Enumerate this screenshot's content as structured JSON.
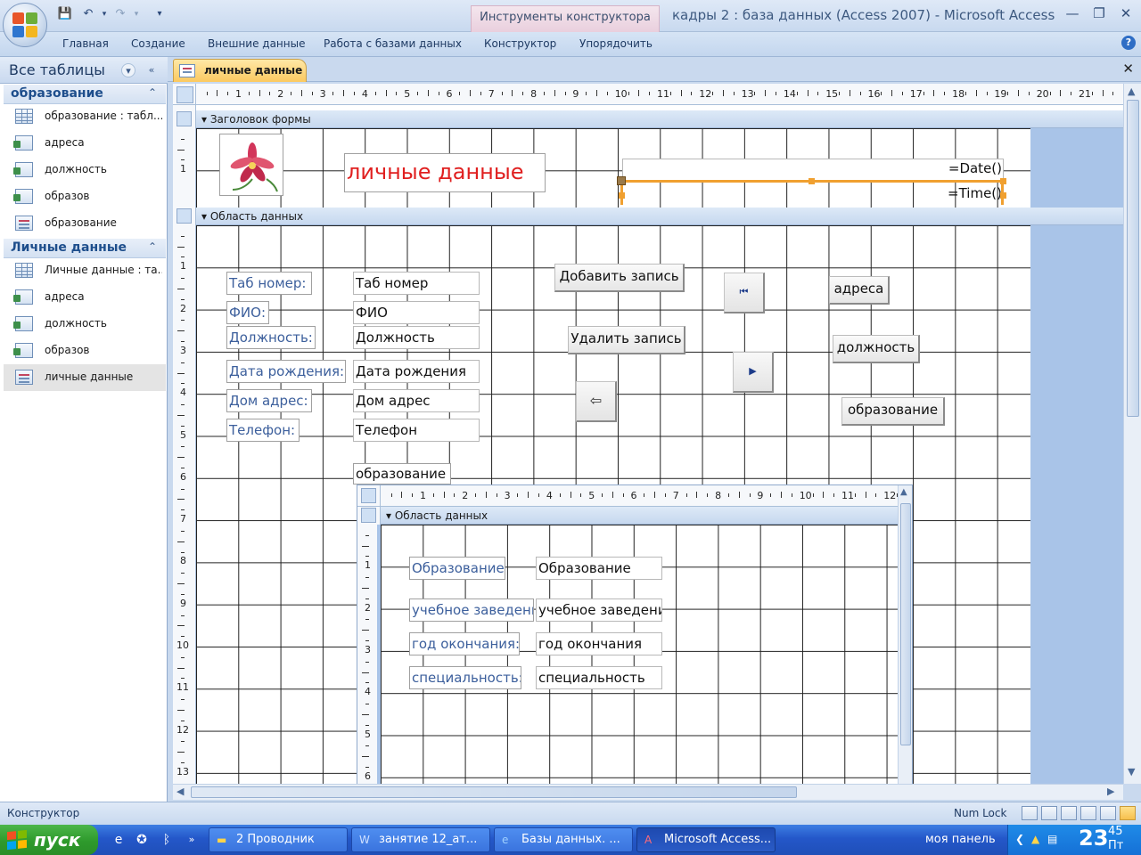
{
  "window": {
    "title": "кадры 2 : база данных (Access 2007) - Microsoft Access",
    "context_tab": "Инструменты конструктора форм",
    "minimize_glyph": "—",
    "maximize_glyph": "❐",
    "close_glyph": "✕"
  },
  "qat": {
    "save_icon": "save-icon",
    "undo_icon": "undo-icon",
    "redo_icon": "redo-icon",
    "customize_icon": "chevron-down-icon"
  },
  "ribbon": {
    "tabs": [
      "Главная",
      "Создание",
      "Внешние данные",
      "Работа с базами данных",
      "Конструктор",
      "Упорядочить"
    ],
    "help_glyph": "?"
  },
  "nav": {
    "title": "Все таблицы",
    "groups": [
      {
        "label": "образование",
        "items": [
          {
            "label": "образование : табл...",
            "icon": "table-icon"
          },
          {
            "label": "адреса",
            "icon": "query-icon"
          },
          {
            "label": "должность",
            "icon": "query-icon"
          },
          {
            "label": "образов",
            "icon": "query-icon"
          },
          {
            "label": "образование",
            "icon": "form-icon"
          }
        ]
      },
      {
        "label": "Личные данные",
        "items": [
          {
            "label": "Личные данные : та...",
            "icon": "table-icon"
          },
          {
            "label": "адреса",
            "icon": "query-icon"
          },
          {
            "label": "должность",
            "icon": "query-icon"
          },
          {
            "label": "образов",
            "icon": "query-icon"
          },
          {
            "label": "личные данные",
            "icon": "form-icon"
          }
        ]
      }
    ]
  },
  "document": {
    "tab_label": "личные данные",
    "close_glyph": "✕"
  },
  "ruler": {
    "h_numbers": [
      "1",
      "2",
      "3",
      "4",
      "5",
      "6",
      "7",
      "8",
      "9",
      "10",
      "11",
      "12",
      "13",
      "14",
      "15",
      "16",
      "17",
      "18",
      "19",
      "20",
      "21"
    ],
    "v_header_numbers": [
      "1"
    ],
    "v_detail_numbers": [
      "1",
      "2",
      "3",
      "4",
      "5",
      "6",
      "7",
      "8",
      "9",
      "10",
      "11",
      "12",
      "13"
    ],
    "sub_h_numbers": [
      "1",
      "2",
      "3",
      "4",
      "5",
      "6",
      "7",
      "8",
      "9",
      "10",
      "11",
      "12"
    ],
    "sub_v_numbers": [
      "1",
      "2",
      "3",
      "4",
      "5",
      "6"
    ]
  },
  "form": {
    "header_section": "Заголовок формы",
    "detail_section": "Область данных",
    "title_label": "личные данные",
    "date_expr": "=Date()",
    "time_expr": "=Time()",
    "fields": [
      {
        "label": "Таб номер:",
        "value": "Таб номер"
      },
      {
        "label": "ФИО:",
        "value": "ФИО"
      },
      {
        "label": "Должность:",
        "value": "Должность"
      },
      {
        "label": "Дата рождения:",
        "value": "Дата рождения"
      },
      {
        "label": "Дом адрес:",
        "value": "Дом адрес"
      },
      {
        "label": "Телефон:",
        "value": "Телефон"
      }
    ],
    "buttons": {
      "add_record": "Добавить запись",
      "delete_record": "Удалить запись",
      "addresses": "адреса",
      "position": "должность",
      "education": "образование"
    },
    "nav_buttons": {
      "first_glyph": "⏮",
      "next_glyph": "▶",
      "exit_glyph": "⇦"
    },
    "subform_label": "образование"
  },
  "subform": {
    "detail_section": "Область данных",
    "fields": [
      {
        "label": "Образование",
        "value": "Образование"
      },
      {
        "label": "учебное заведени",
        "value": "учебное заведени"
      },
      {
        "label": "год окончания:",
        "value": "год окончания"
      },
      {
        "label": "специальность:",
        "value": "специальность"
      }
    ]
  },
  "status": {
    "mode": "Конструктор",
    "numlock": "Num Lock"
  },
  "taskbar": {
    "start": "пуск",
    "buttons": [
      "2 Проводник",
      "занятие 12_ат...",
      "Базы данных. ...",
      "Microsoft Access..."
    ],
    "tray_label": "моя панель",
    "clock_hour": "23",
    "clock_minute": "45",
    "clock_day": "Пт"
  },
  "colors": {
    "title_label": "#e02020",
    "label_text": "#3c5f9c",
    "selection_orange": "#f0a030"
  }
}
